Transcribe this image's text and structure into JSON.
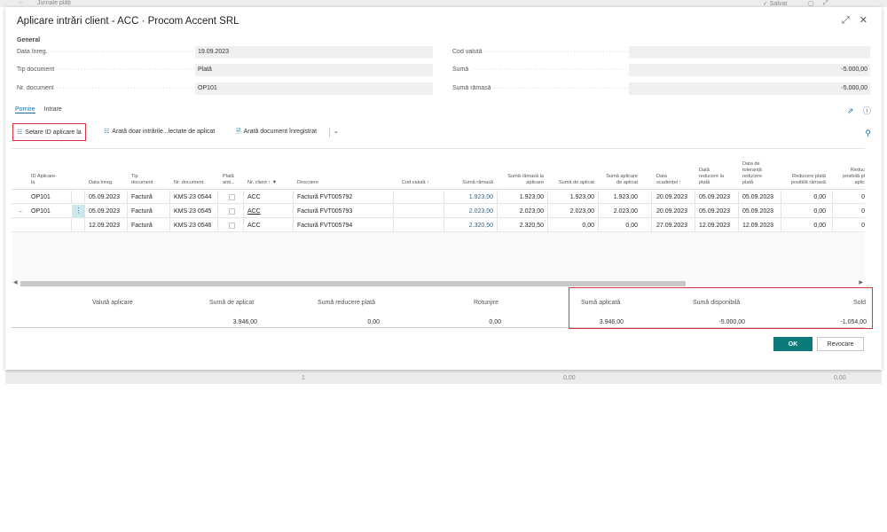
{
  "background": {
    "back_icon": "←",
    "title": "Jurnale plăți",
    "saved": "✓ Salvat",
    "bottom": {
      "v1": "1",
      "v2": "0,00",
      "v3": "0,00"
    }
  },
  "dialog": {
    "title": "Aplicare intrări client - ACC · Procom Accent SRL",
    "expand_icon": "⤢",
    "close_icon": "✕"
  },
  "general": {
    "section_label": "General",
    "fields": {
      "data_inreg": {
        "label": "Data înreg.",
        "value": "19.09.2023"
      },
      "tip_document": {
        "label": "Tip document",
        "value": "Plată"
      },
      "nr_document": {
        "label": "Nr. document",
        "value": "OP101"
      },
      "cod_valuta": {
        "label": "Cod valută",
        "value": ""
      },
      "suma": {
        "label": "Sumă",
        "value": "-5.000,00"
      },
      "suma_ramasa": {
        "label": "Sumă rămasă",
        "value": "-5.000,00"
      }
    }
  },
  "tabs": {
    "home": "Pornire",
    "entry": "Intrare"
  },
  "actions": {
    "set_applies_to_id": "Setare ID aplicare la",
    "show_only_selected": "Arată doar intrările...lectate de aplicat",
    "show_posted_document": "Arată document înregistrat",
    "more": "⌄"
  },
  "grid": {
    "headers": {
      "id_aplicare": [
        "ID Aplicare-",
        "la"
      ],
      "data_inreg": [
        "Data înreg."
      ],
      "tip_document": [
        "Tip",
        "document"
      ],
      "nr_document": [
        "Nr. document"
      ],
      "plata_anti": [
        "Plată",
        "anti..."
      ],
      "nr_client": [
        "Nr. client ↑ ▼"
      ],
      "descriere": [
        "Descriere"
      ],
      "cod_valuta": [
        "Cod valută ↑"
      ],
      "suma_ramasa": [
        "Sumă rămasă"
      ],
      "suma_ramasa_aplicare": [
        "Sumă rămasă la",
        "aplicare"
      ],
      "suma_de_aplicat": [
        "Sumă de aplicat"
      ],
      "suma_aplicare_de_aplicat": [
        "Sumă aplicare",
        "de aplicat"
      ],
      "data_scadentei": [
        "Data",
        "scadenței ↑"
      ],
      "data_reducere_plata": [
        "Dată",
        "reducere la",
        "plată"
      ],
      "data_toleranta": [
        "Data de",
        "toleranță",
        "reducere",
        "plată"
      ],
      "reducere_plata": [
        "Reducere plată",
        "posibilă rămasă"
      ],
      "reducere_posibila": [
        "Reduc",
        "posibilă pl",
        "aplic"
      ]
    },
    "rows": [
      {
        "arrow": "",
        "id_aplicare": "OP101",
        "data_inreg": "05.09.2023",
        "tip_document": "Factură",
        "nr_document": "KMS 23 0544",
        "nr_client": "ACC",
        "descriere": "Factură FVT005792",
        "cod_valuta": "",
        "suma_ramasa": "1.923,00",
        "suma_ramasa_aplicare": "1.923,00",
        "suma_de_aplicat": "1.923,00",
        "suma_aplicare_de_aplicat": "1.923,00",
        "data_scadentei": "20.09.2023",
        "data_reducere_plata": "05.09.2023",
        "data_toleranta": "05.09.2023",
        "reducere_plata": "0,00",
        "reducere_posibila": "0"
      },
      {
        "arrow": "→",
        "id_aplicare": "OP101",
        "data_inreg": "05.09.2023",
        "tip_document": "Factură",
        "nr_document": "KMS 23 0545",
        "nr_client": "ACC",
        "descriere": "Factură FVT005793",
        "cod_valuta": "",
        "suma_ramasa": "2.023,00",
        "suma_ramasa_aplicare": "2.023,00",
        "suma_de_aplicat": "2.023,00",
        "suma_aplicare_de_aplicat": "2.023,00",
        "data_scadentei": "20.09.2023",
        "data_reducere_plata": "05.09.2023",
        "data_toleranta": "05.09.2023",
        "reducere_plata": "0,00",
        "reducere_posibila": "0"
      },
      {
        "arrow": "",
        "id_aplicare": "",
        "data_inreg": "12.09.2023",
        "tip_document": "Factură",
        "nr_document": "KMS 23 0546",
        "nr_client": "ACC",
        "descriere": "Factură FVT005794",
        "cod_valuta": "",
        "suma_ramasa": "2.320,50",
        "suma_ramasa_aplicare": "2.320,50",
        "suma_de_aplicat": "0,00",
        "suma_aplicare_de_aplicat": "0,00",
        "data_scadentei": "27.09.2023",
        "data_reducere_plata": "12.09.2023",
        "data_toleranta": "12.09.2023",
        "reducere_plata": "0,00",
        "reducere_posibila": "0"
      }
    ]
  },
  "totals": {
    "valuta_aplicare": {
      "label": "Valută aplicare",
      "value": ""
    },
    "suma_de_aplicat": {
      "label": "Sumă de aplicat",
      "value": "3.946,00"
    },
    "suma_reducere_plata": {
      "label": "Sumă reducere plată",
      "value": "0,00"
    },
    "rotunjire": {
      "label": "Rotunjire",
      "value": "0,00"
    },
    "suma_aplicata": {
      "label": "Sumă aplicată",
      "value": "3.946,00"
    },
    "suma_disponibila": {
      "label": "Sumă disponibilă",
      "value": "-5.000,00"
    },
    "sold": {
      "label": "Sold",
      "value": "-1.054,00"
    }
  },
  "buttons": {
    "ok": "OK",
    "cancel": "Revocare"
  },
  "colors": {
    "accent": "#0c7a7a",
    "link": "#1e6b9a",
    "highlight": "#d9333f"
  }
}
